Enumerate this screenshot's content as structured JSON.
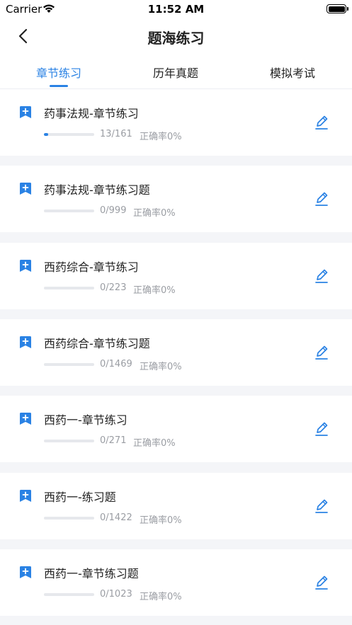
{
  "status_bar": {
    "carrier": "Carrier",
    "time": "11:52 AM"
  },
  "nav": {
    "title": "题海练习"
  },
  "tabs": [
    {
      "label": "章节练习",
      "active": true
    },
    {
      "label": "历年真题",
      "active": false
    },
    {
      "label": "模拟考试",
      "active": false
    }
  ],
  "accent_color": "#2a82e4",
  "items": [
    {
      "title": "药事法规-章节练习",
      "count": "13/161",
      "accuracy": "正确率0%",
      "progress": 0.081
    },
    {
      "title": "药事法规-章节练习题",
      "count": "0/999",
      "accuracy": "正确率0%",
      "progress": 0
    },
    {
      "title": "西药综合-章节练习",
      "count": "0/223",
      "accuracy": "正确率0%",
      "progress": 0
    },
    {
      "title": "西药综合-章节练习题",
      "count": "0/1469",
      "accuracy": "正确率0%",
      "progress": 0
    },
    {
      "title": "西药一-章节练习",
      "count": "0/271",
      "accuracy": "正确率0%",
      "progress": 0
    },
    {
      "title": "西药一-练习题",
      "count": "0/1422",
      "accuracy": "正确率0%",
      "progress": 0
    },
    {
      "title": "西药一-章节练习题",
      "count": "0/1023",
      "accuracy": "正确率0%",
      "progress": 0
    }
  ]
}
